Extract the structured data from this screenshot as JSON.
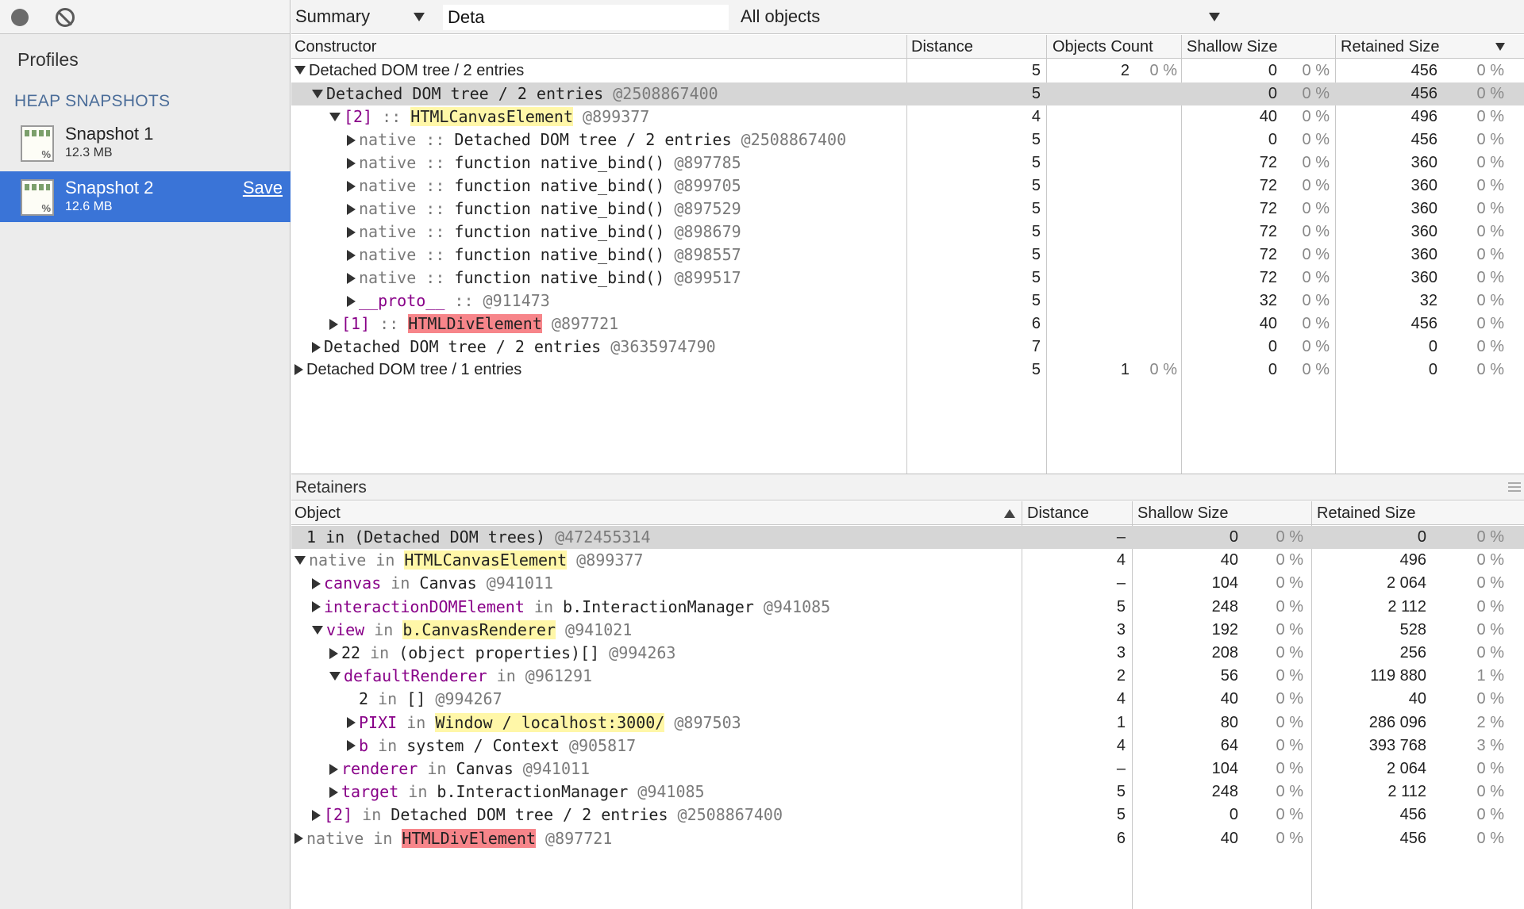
{
  "sidebar": {
    "profiles_title": "Profiles",
    "section_title": "HEAP SNAPSHOTS",
    "snapshots": [
      {
        "name": "Snapshot 1",
        "size": "12.3 MB"
      },
      {
        "name": "Snapshot 2",
        "size": "12.6 MB",
        "save": "Save"
      }
    ]
  },
  "toolbar": {
    "view": "Summary",
    "filter_value": "Deta",
    "objects": "All objects"
  },
  "heap": {
    "columns": [
      "Constructor",
      "Distance",
      "Objects Count",
      "Shallow Size",
      "Retained Size"
    ],
    "rows": [
      {
        "indent": 0,
        "tri": "d",
        "parts": [
          [
            "",
            "Detached DOM tree / 2 entries"
          ]
        ],
        "dist": "5",
        "count": "2",
        "count_pct": "0 %",
        "shallow": "0",
        "shallow_pct": "0 %",
        "retained": "456",
        "retained_pct": "0 %"
      },
      {
        "indent": 1,
        "tri": "d",
        "mono": true,
        "sel": true,
        "parts": [
          [
            "",
            "Detached DOM tree / 2 entries "
          ],
          [
            "g",
            "@2508867400"
          ]
        ],
        "dist": "5",
        "count": "",
        "count_pct": "",
        "shallow": "0",
        "shallow_pct": "0 %",
        "retained": "456",
        "retained_pct": "0 %"
      },
      {
        "indent": 2,
        "tri": "d",
        "mono": true,
        "parts": [
          [
            "p",
            "[2]"
          ],
          [
            "g",
            " :: "
          ],
          [
            "hl-y",
            "HTMLCanvasElement"
          ],
          [
            "g",
            " @899377"
          ]
        ],
        "dist": "4",
        "count": "",
        "count_pct": "",
        "shallow": "40",
        "shallow_pct": "0 %",
        "retained": "496",
        "retained_pct": "0 %"
      },
      {
        "indent": 3,
        "tri": "r",
        "mono": true,
        "parts": [
          [
            "g",
            "native :: "
          ],
          [
            "",
            "Detached DOM tree / 2 entries "
          ],
          [
            "g",
            "@2508867400"
          ]
        ],
        "dist": "5",
        "count": "",
        "count_pct": "",
        "shallow": "0",
        "shallow_pct": "0 %",
        "retained": "456",
        "retained_pct": "0 %"
      },
      {
        "indent": 3,
        "tri": "r",
        "mono": true,
        "parts": [
          [
            "g",
            "native :: "
          ],
          [
            "",
            "function native_bind() "
          ],
          [
            "g",
            "@897785"
          ]
        ],
        "dist": "5",
        "count": "",
        "count_pct": "",
        "shallow": "72",
        "shallow_pct": "0 %",
        "retained": "360",
        "retained_pct": "0 %"
      },
      {
        "indent": 3,
        "tri": "r",
        "mono": true,
        "parts": [
          [
            "g",
            "native :: "
          ],
          [
            "",
            "function native_bind() "
          ],
          [
            "g",
            "@899705"
          ]
        ],
        "dist": "5",
        "count": "",
        "count_pct": "",
        "shallow": "72",
        "shallow_pct": "0 %",
        "retained": "360",
        "retained_pct": "0 %"
      },
      {
        "indent": 3,
        "tri": "r",
        "mono": true,
        "parts": [
          [
            "g",
            "native :: "
          ],
          [
            "",
            "function native_bind() "
          ],
          [
            "g",
            "@897529"
          ]
        ],
        "dist": "5",
        "count": "",
        "count_pct": "",
        "shallow": "72",
        "shallow_pct": "0 %",
        "retained": "360",
        "retained_pct": "0 %"
      },
      {
        "indent": 3,
        "tri": "r",
        "mono": true,
        "parts": [
          [
            "g",
            "native :: "
          ],
          [
            "",
            "function native_bind() "
          ],
          [
            "g",
            "@898679"
          ]
        ],
        "dist": "5",
        "count": "",
        "count_pct": "",
        "shallow": "72",
        "shallow_pct": "0 %",
        "retained": "360",
        "retained_pct": "0 %"
      },
      {
        "indent": 3,
        "tri": "r",
        "mono": true,
        "parts": [
          [
            "g",
            "native :: "
          ],
          [
            "",
            "function native_bind() "
          ],
          [
            "g",
            "@898557"
          ]
        ],
        "dist": "5",
        "count": "",
        "count_pct": "",
        "shallow": "72",
        "shallow_pct": "0 %",
        "retained": "360",
        "retained_pct": "0 %"
      },
      {
        "indent": 3,
        "tri": "r",
        "mono": true,
        "parts": [
          [
            "g",
            "native :: "
          ],
          [
            "",
            "function native_bind() "
          ],
          [
            "g",
            "@899517"
          ]
        ],
        "dist": "5",
        "count": "",
        "count_pct": "",
        "shallow": "72",
        "shallow_pct": "0 %",
        "retained": "360",
        "retained_pct": "0 %"
      },
      {
        "indent": 3,
        "tri": "r",
        "mono": true,
        "parts": [
          [
            "p",
            "__proto__"
          ],
          [
            "g",
            " :: @911473"
          ]
        ],
        "dist": "5",
        "count": "",
        "count_pct": "",
        "shallow": "32",
        "shallow_pct": "0 %",
        "retained": "32",
        "retained_pct": "0 %"
      },
      {
        "indent": 2,
        "tri": "r",
        "mono": true,
        "parts": [
          [
            "p",
            "[1]"
          ],
          [
            "g",
            " :: "
          ],
          [
            "hl-r",
            "HTMLDivElement"
          ],
          [
            "g",
            " @897721"
          ]
        ],
        "dist": "6",
        "count": "",
        "count_pct": "",
        "shallow": "40",
        "shallow_pct": "0 %",
        "retained": "456",
        "retained_pct": "0 %"
      },
      {
        "indent": 1,
        "tri": "r",
        "mono": true,
        "parts": [
          [
            "",
            "Detached DOM tree / 2 entries "
          ],
          [
            "g",
            "@3635974790"
          ]
        ],
        "dist": "7",
        "count": "",
        "count_pct": "",
        "shallow": "0",
        "shallow_pct": "0 %",
        "retained": "0",
        "retained_pct": "0 %"
      },
      {
        "indent": 0,
        "tri": "r",
        "parts": [
          [
            "",
            "Detached DOM tree / 1 entries"
          ]
        ],
        "dist": "5",
        "count": "1",
        "count_pct": "0 %",
        "shallow": "0",
        "shallow_pct": "0 %",
        "retained": "0",
        "retained_pct": "0 %"
      }
    ]
  },
  "retainers": {
    "title": "Retainers",
    "columns": [
      "Object",
      "Distance",
      "Shallow Size",
      "Retained Size"
    ],
    "rows": [
      {
        "indent": 0,
        "tri": "none",
        "mono": true,
        "sel": true,
        "parts": [
          [
            "",
            "1 in (Detached DOM trees) "
          ],
          [
            "g",
            "@472455314"
          ]
        ],
        "dist": "–",
        "shallow": "0",
        "shallow_pct": "0 %",
        "retained": "0",
        "retained_pct": "0 %"
      },
      {
        "indent": 0,
        "tri": "d",
        "mono": true,
        "parts": [
          [
            "g",
            "native in "
          ],
          [
            "hl-y",
            "HTMLCanvasElement"
          ],
          [
            "g",
            " @899377"
          ]
        ],
        "dist": "4",
        "shallow": "40",
        "shallow_pct": "0 %",
        "retained": "496",
        "retained_pct": "0 %"
      },
      {
        "indent": 1,
        "tri": "r",
        "mono": true,
        "parts": [
          [
            "p",
            "canvas"
          ],
          [
            "g",
            " in "
          ],
          [
            "",
            "Canvas "
          ],
          [
            "g",
            "@941011"
          ]
        ],
        "dist": "–",
        "shallow": "104",
        "shallow_pct": "0 %",
        "retained": "2 064",
        "retained_pct": "0 %"
      },
      {
        "indent": 1,
        "tri": "r",
        "mono": true,
        "parts": [
          [
            "p",
            "interactionDOMElement"
          ],
          [
            "g",
            " in "
          ],
          [
            "",
            "b.InteractionManager "
          ],
          [
            "g",
            "@941085"
          ]
        ],
        "dist": "5",
        "shallow": "248",
        "shallow_pct": "0 %",
        "retained": "2 112",
        "retained_pct": "0 %"
      },
      {
        "indent": 1,
        "tri": "d",
        "mono": true,
        "parts": [
          [
            "p",
            "view"
          ],
          [
            "g",
            " in "
          ],
          [
            "hl-y",
            "b.CanvasRenderer"
          ],
          [
            "g",
            " @941021"
          ]
        ],
        "dist": "3",
        "shallow": "192",
        "shallow_pct": "0 %",
        "retained": "528",
        "retained_pct": "0 %"
      },
      {
        "indent": 2,
        "tri": "r",
        "mono": true,
        "parts": [
          [
            "",
            "22"
          ],
          [
            "g",
            " in "
          ],
          [
            "",
            "(object properties)[] "
          ],
          [
            "g",
            "@994263"
          ]
        ],
        "dist": "3",
        "shallow": "208",
        "shallow_pct": "0 %",
        "retained": "256",
        "retained_pct": "0 %"
      },
      {
        "indent": 2,
        "tri": "d",
        "mono": true,
        "parts": [
          [
            "p",
            "defaultRenderer"
          ],
          [
            "g",
            " in @961291"
          ]
        ],
        "dist": "2",
        "shallow": "56",
        "shallow_pct": "0 %",
        "retained": "119 880",
        "retained_pct": "1 %"
      },
      {
        "indent": 3,
        "tri": "none",
        "mono": true,
        "parts": [
          [
            "",
            "2"
          ],
          [
            "g",
            " in "
          ],
          [
            "",
            "[] "
          ],
          [
            "g",
            "@994267"
          ]
        ],
        "dist": "4",
        "shallow": "40",
        "shallow_pct": "0 %",
        "retained": "40",
        "retained_pct": "0 %"
      },
      {
        "indent": 3,
        "tri": "r",
        "mono": true,
        "parts": [
          [
            "p",
            "PIXI"
          ],
          [
            "g",
            " in "
          ],
          [
            "hl-y",
            "Window / localhost:3000/"
          ],
          [
            "g",
            " @897503"
          ]
        ],
        "dist": "1",
        "shallow": "80",
        "shallow_pct": "0 %",
        "retained": "286 096",
        "retained_pct": "2 %"
      },
      {
        "indent": 3,
        "tri": "r",
        "mono": true,
        "parts": [
          [
            "p",
            "b"
          ],
          [
            "g",
            " in "
          ],
          [
            "",
            "system / Context "
          ],
          [
            "g",
            "@905817"
          ]
        ],
        "dist": "4",
        "shallow": "64",
        "shallow_pct": "0 %",
        "retained": "393 768",
        "retained_pct": "3 %"
      },
      {
        "indent": 2,
        "tri": "r",
        "mono": true,
        "parts": [
          [
            "p",
            "renderer"
          ],
          [
            "g",
            " in "
          ],
          [
            "",
            "Canvas "
          ],
          [
            "g",
            "@941011"
          ]
        ],
        "dist": "–",
        "shallow": "104",
        "shallow_pct": "0 %",
        "retained": "2 064",
        "retained_pct": "0 %"
      },
      {
        "indent": 2,
        "tri": "r",
        "mono": true,
        "parts": [
          [
            "p",
            "target"
          ],
          [
            "g",
            " in "
          ],
          [
            "",
            "b.InteractionManager "
          ],
          [
            "g",
            "@941085"
          ]
        ],
        "dist": "5",
        "shallow": "248",
        "shallow_pct": "0 %",
        "retained": "2 112",
        "retained_pct": "0 %"
      },
      {
        "indent": 1,
        "tri": "r",
        "mono": true,
        "parts": [
          [
            "p",
            "[2]"
          ],
          [
            "g",
            " in "
          ],
          [
            "",
            "Detached DOM tree / 2 entries "
          ],
          [
            "g",
            "@2508867400"
          ]
        ],
        "dist": "5",
        "shallow": "0",
        "shallow_pct": "0 %",
        "retained": "456",
        "retained_pct": "0 %"
      },
      {
        "indent": 0,
        "tri": "r",
        "mono": true,
        "parts": [
          [
            "g",
            "native in "
          ],
          [
            "hl-r",
            "HTMLDivElement"
          ],
          [
            "g",
            " @897721"
          ]
        ],
        "dist": "6",
        "shallow": "40",
        "shallow_pct": "0 %",
        "retained": "456",
        "retained_pct": "0 %"
      }
    ]
  }
}
